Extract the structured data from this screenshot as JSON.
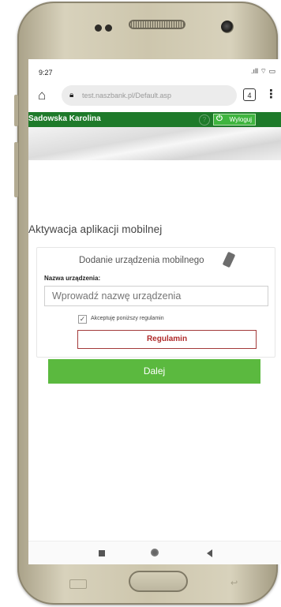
{
  "status_bar": {
    "time": "9:27",
    "icons": ".ıll ⌔ ▭"
  },
  "browser": {
    "url": "test.naszbank.pl/Default.asp",
    "tabs_count": "4"
  },
  "header": {
    "user_name": "Sadowska Karolina",
    "help_symbol": "?",
    "logout_label": "Wyloguj"
  },
  "page": {
    "title": "Aktywacja aplikacji mobilnej"
  },
  "form": {
    "panel_title": "Dodanie urządzenia mobilnego",
    "device_name_label": "Nazwa urządzenia:",
    "device_name_placeholder": "Wprowadź nazwę urządzenia",
    "terms_checkbox_label": "Akceptuję poniższy regulamin",
    "terms_checked": true,
    "regulamin_button": "Regulamin",
    "next_button": "Dalej"
  },
  "colors": {
    "brand_green": "#1e7a2a",
    "button_green": "#5bb93f",
    "regulamin_red": "#b02b2b"
  }
}
